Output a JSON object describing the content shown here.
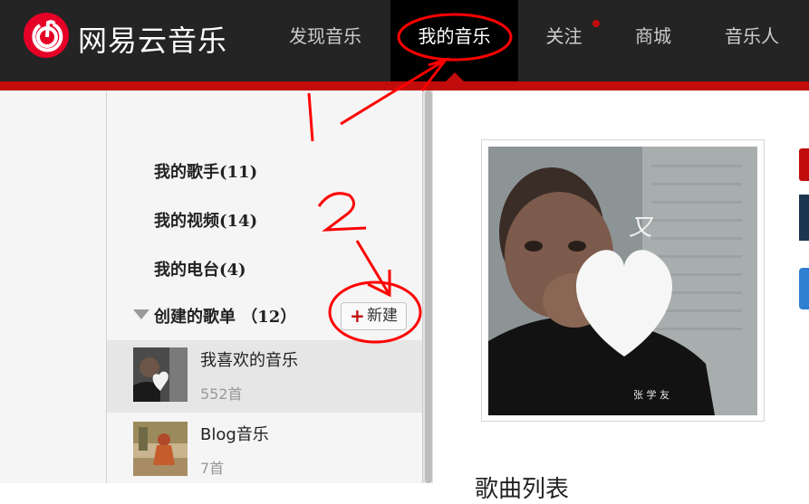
{
  "brand": {
    "name": "网易云音乐",
    "color": "#e60026"
  },
  "nav": {
    "items": [
      {
        "label": "发现音乐"
      },
      {
        "label": "我的音乐",
        "active": true
      },
      {
        "label": "关注",
        "has_dot": true
      },
      {
        "label": "商城"
      },
      {
        "label": "音乐人"
      }
    ]
  },
  "sidebar": {
    "links": [
      {
        "label": "我的歌手(11)"
      },
      {
        "label": "我的视频(14)"
      },
      {
        "label": "我的电台(4)"
      }
    ],
    "created_header": "创建的歌单 （12）",
    "new_button": "新建",
    "playlists": [
      {
        "title": "我喜欢的音乐",
        "count": "552首",
        "selected": true
      },
      {
        "title": "Blog音乐",
        "count": "7首"
      }
    ]
  },
  "main": {
    "cover_artist": "张 学 友",
    "heading": "歌曲列表"
  },
  "annotations": {
    "one": "1",
    "two": "2"
  },
  "colors": {
    "accent_red": "#c20c0c",
    "topbar": "#242424",
    "annotation": "#ff0000"
  }
}
